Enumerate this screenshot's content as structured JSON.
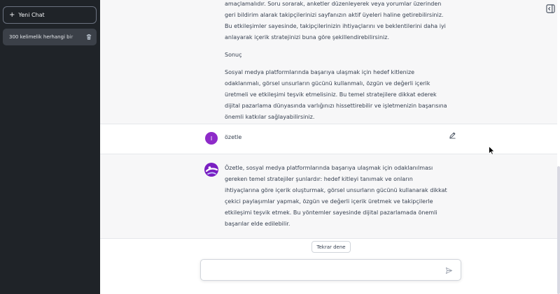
{
  "sidebar": {
    "new_chat_label": "Yeni Chat",
    "history": [
      {
        "label": "300 kelimelik herhangi bir"
      }
    ]
  },
  "conversation": {
    "assistant_message_1": {
      "paragraphs": [
        "amaçlamalıdır. Soru sorarak, anketler düzenleyerek veya yorumlar üzerinden geri bildirim alarak takipçilerinizi sayfanızın aktif üyeleri haline getirebilirsiniz. Bu etkileşimler sayesinde, takipçilerinizin ihtiyaçlarını ve beklentilerini daha iyi anlayarak içerik stratejinizi buna göre şekillendirebilirsiniz.",
        "Sonuç",
        "Sosyal medya platformlarında başarıya ulaşmak için hedef kitlenize odaklanmalı, görsel unsurların gücünü kullanmalı, özgün ve değerli içerik üretmeli ve etkileşimi teşvik etmelisiniz. Bu temel stratejilere dikkat ederek dijital pazarlama dünyasında varlığınızı hissettirebilir ve işletmenizin başarısına önemli katkılar sağlayabilirsiniz."
      ]
    },
    "user_message": {
      "avatar_letter": "I",
      "text": "özetle"
    },
    "assistant_message_2": {
      "paragraphs": [
        "Özetle, sosyal medya platformlarında başarıya ulaşmak için odaklanılması gereken temel stratejiler şunlardır: hedef kitleyi tanımak ve onların ihtiyaçlarına göre içerik oluşturmak, görsel unsurların gücünü kullanarak dikkat çekici paylaşımlar yapmak, özgün ve değerli içerik üretmek ve takipçilerle etkileşimi teşvik etmek. Bu yöntemler sayesinde dijital pazarlamada önemli başarılar elde edilebilir."
      ]
    }
  },
  "controls": {
    "retry_label": "Tekrar dene",
    "input_value": "",
    "input_placeholder": ""
  },
  "icons": {
    "collapse": "sidebar-collapse-icon",
    "edit": "pencil-icon",
    "trash": "trash-icon",
    "send": "send-icon",
    "plus": "plus-icon"
  },
  "colors": {
    "sidebar_bg": "#1f2328",
    "user_avatar": "#8e2bc9",
    "assistant_bg": "#f7f7f8",
    "bot_avatar": "#7a1fc2"
  }
}
